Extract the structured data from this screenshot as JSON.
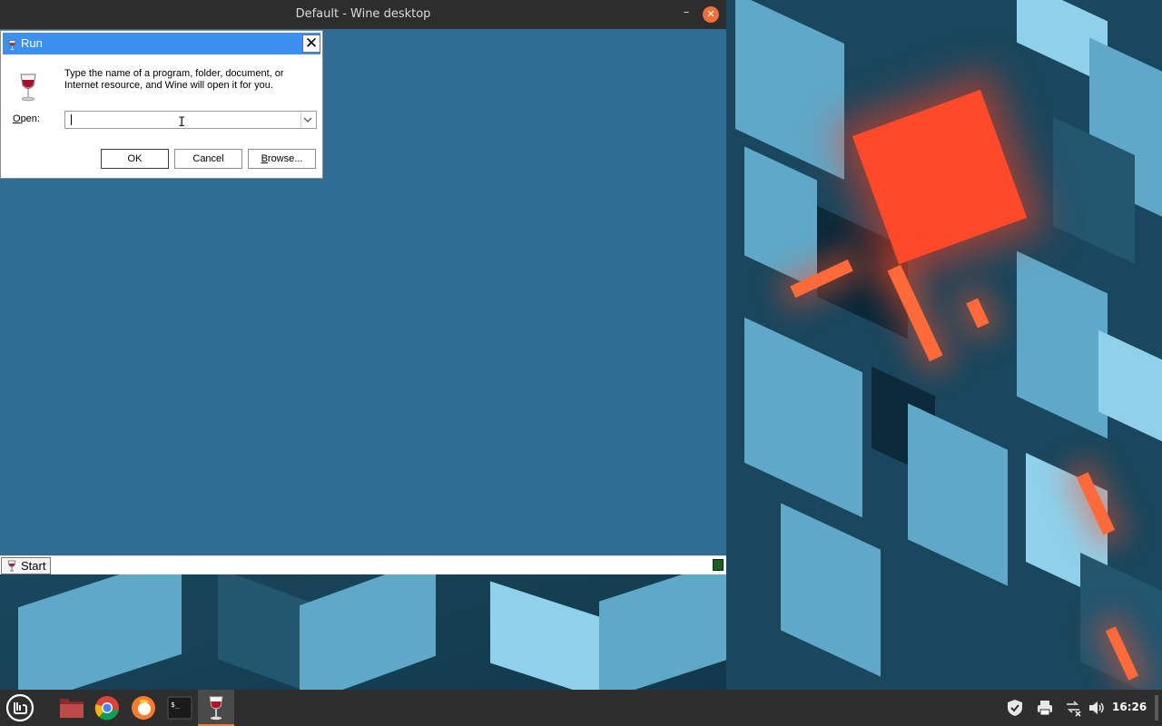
{
  "wine_window": {
    "title": "Default - Wine desktop",
    "minimize_symbol": "–",
    "close_symbol": "✕",
    "taskbar": {
      "start_label": "Start"
    }
  },
  "run_dialog": {
    "title": "Run",
    "close_symbol": "✕",
    "description": "Type the name of a program, folder, document, or Internet resource, and Wine will open it for you.",
    "open_label_accel": "O",
    "open_label_rest": "pen:",
    "open_value": "",
    "ok_label": "OK",
    "cancel_label": "Cancel",
    "browse_label_accel": "B",
    "browse_label_rest": "rowse..."
  },
  "panel": {
    "launchers": [
      "menu-icon",
      "files-icon",
      "chrome-icon",
      "firefox-icon",
      "terminal-icon",
      "wine-icon"
    ],
    "terminal_glyph": "$_",
    "tray_icons": [
      "shield-icon",
      "printer-icon",
      "network-icon",
      "volume-icon"
    ],
    "clock": "16:26"
  },
  "colors": {
    "wine_desktop": "#306d94",
    "run_titlebar": "#3d90ef",
    "close_accent": "#f0703a",
    "panel": "#2e2e2e"
  }
}
